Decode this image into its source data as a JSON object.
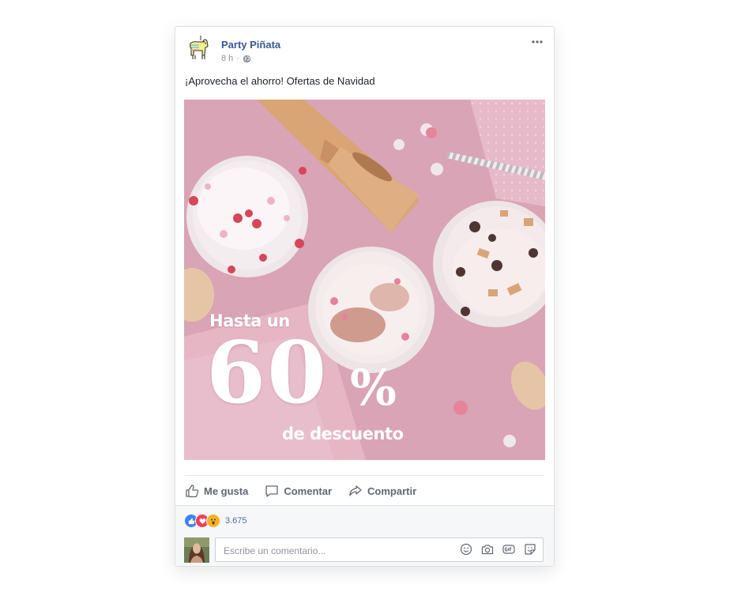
{
  "post": {
    "page_name": "Party Piñata",
    "time": "8 h",
    "separator": "·",
    "audience_icon": "globe-icon",
    "text": "¡Aprovecha el ahorro! Ofertas de Navidad",
    "image": {
      "promo_prefix": "Hasta un",
      "promo_number": "60",
      "promo_percent": "%",
      "promo_suffix": "de descuento"
    }
  },
  "actions": [
    {
      "label": "Me gusta",
      "icon": "thumbs-up-icon"
    },
    {
      "label": "Comentar",
      "icon": "comment-icon"
    },
    {
      "label": "Compartir",
      "icon": "share-icon"
    }
  ],
  "reactions": {
    "icons": [
      "like-reaction-icon",
      "love-reaction-icon",
      "wow-reaction-icon"
    ],
    "count": "3.675"
  },
  "comment": {
    "placeholder": "Escribe un comentario...",
    "icons": [
      "emoji-icon",
      "camera-icon",
      "gif-icon",
      "sticker-icon"
    ]
  },
  "colors": {
    "link": "#365899",
    "like_blue": "#3b82f6",
    "love_red": "#f33e58",
    "wow_yellow": "#f7b125",
    "photo_pink": "#dba8ba"
  }
}
